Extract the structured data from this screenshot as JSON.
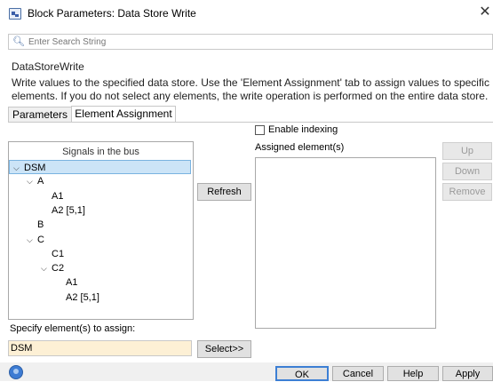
{
  "window": {
    "title": "Block Parameters: Data Store Write"
  },
  "search": {
    "placeholder": "Enter Search String"
  },
  "block": {
    "name": "DataStoreWrite",
    "description": "Write values to the specified data store. Use the 'Element Assignment' tab to assign values to specific elements. If you do not select any elements, the write operation is performed on the entire data store."
  },
  "tabs": [
    {
      "label": "Parameters"
    },
    {
      "label": "Element Assignment"
    }
  ],
  "tree": {
    "header": "Signals in the bus",
    "items": [
      {
        "label": "DSM",
        "indent": 0,
        "expanded": true,
        "selected": true
      },
      {
        "label": "A",
        "indent": 1,
        "expanded": true
      },
      {
        "label": "A1",
        "indent": 2
      },
      {
        "label": "A2 [5,1]",
        "indent": 2
      },
      {
        "label": "B",
        "indent": 1
      },
      {
        "label": "C",
        "indent": 1,
        "expanded": true
      },
      {
        "label": "C1",
        "indent": 2
      },
      {
        "label": "C2",
        "indent": 2,
        "expanded": true
      },
      {
        "label": "A1",
        "indent": 3
      },
      {
        "label": "A2 [5,1]",
        "indent": 3
      }
    ]
  },
  "buttons": {
    "refresh": "Refresh",
    "up": "Up",
    "down": "Down",
    "remove": "Remove",
    "select": "Select>>",
    "ok": "OK",
    "cancel": "Cancel",
    "help": "Help",
    "apply": "Apply"
  },
  "indexing": {
    "label": "Enable indexing",
    "checked": false
  },
  "assigned": {
    "label": "Assigned element(s)",
    "items": []
  },
  "specify": {
    "label": "Specify element(s) to assign:",
    "value": "DSM"
  },
  "colors": {
    "selection": "#cce4f7",
    "input_bg": "#fdf0d5"
  }
}
